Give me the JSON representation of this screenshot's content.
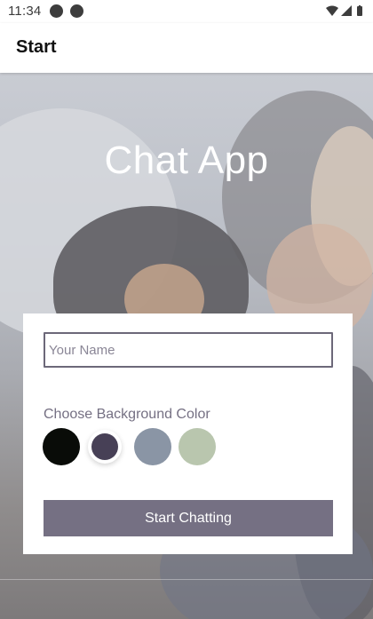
{
  "status_bar": {
    "time": "11:34",
    "icons": [
      "app-icon-a",
      "app-icon-b",
      "wifi-icon",
      "signal-icon",
      "battery-icon"
    ]
  },
  "app_bar": {
    "title": "Start"
  },
  "hero": {
    "title": "Chat App"
  },
  "form": {
    "name_input": {
      "value": "",
      "placeholder": "Your Name"
    },
    "color_label": "Choose Background Color",
    "colors": [
      {
        "name": "black",
        "hex": "#090C08",
        "selected": false
      },
      {
        "name": "dark-purple",
        "hex": "#474056",
        "selected": true
      },
      {
        "name": "slate",
        "hex": "#8A95A5",
        "selected": false
      },
      {
        "name": "sage",
        "hex": "#B9C6AE",
        "selected": false
      }
    ],
    "start_button_label": "Start Chatting"
  },
  "theme": {
    "accent": "#757083"
  }
}
